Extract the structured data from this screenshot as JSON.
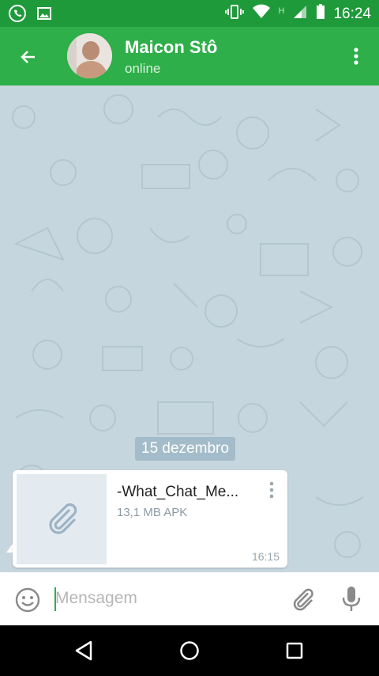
{
  "status_bar": {
    "time": "16:24",
    "network_label": "H",
    "icons": [
      "whatsapp-icon",
      "image-icon",
      "vibrate-icon",
      "wifi-icon",
      "signal-icon",
      "battery-icon"
    ]
  },
  "header": {
    "contact_name": "Maicon Stô",
    "contact_status": "online",
    "accent_color": "#2eaf49"
  },
  "chat": {
    "date_separator": "15 dezembro",
    "messages": [
      {
        "type": "file",
        "file_name": "-What_Chat_Me...",
        "file_meta": "13,1 MB APK",
        "time": "16:15"
      }
    ]
  },
  "input_bar": {
    "placeholder": "Mensagem"
  },
  "nav_bar": {
    "icons": [
      "back-nav-icon",
      "home-nav-icon",
      "recents-nav-icon"
    ]
  }
}
